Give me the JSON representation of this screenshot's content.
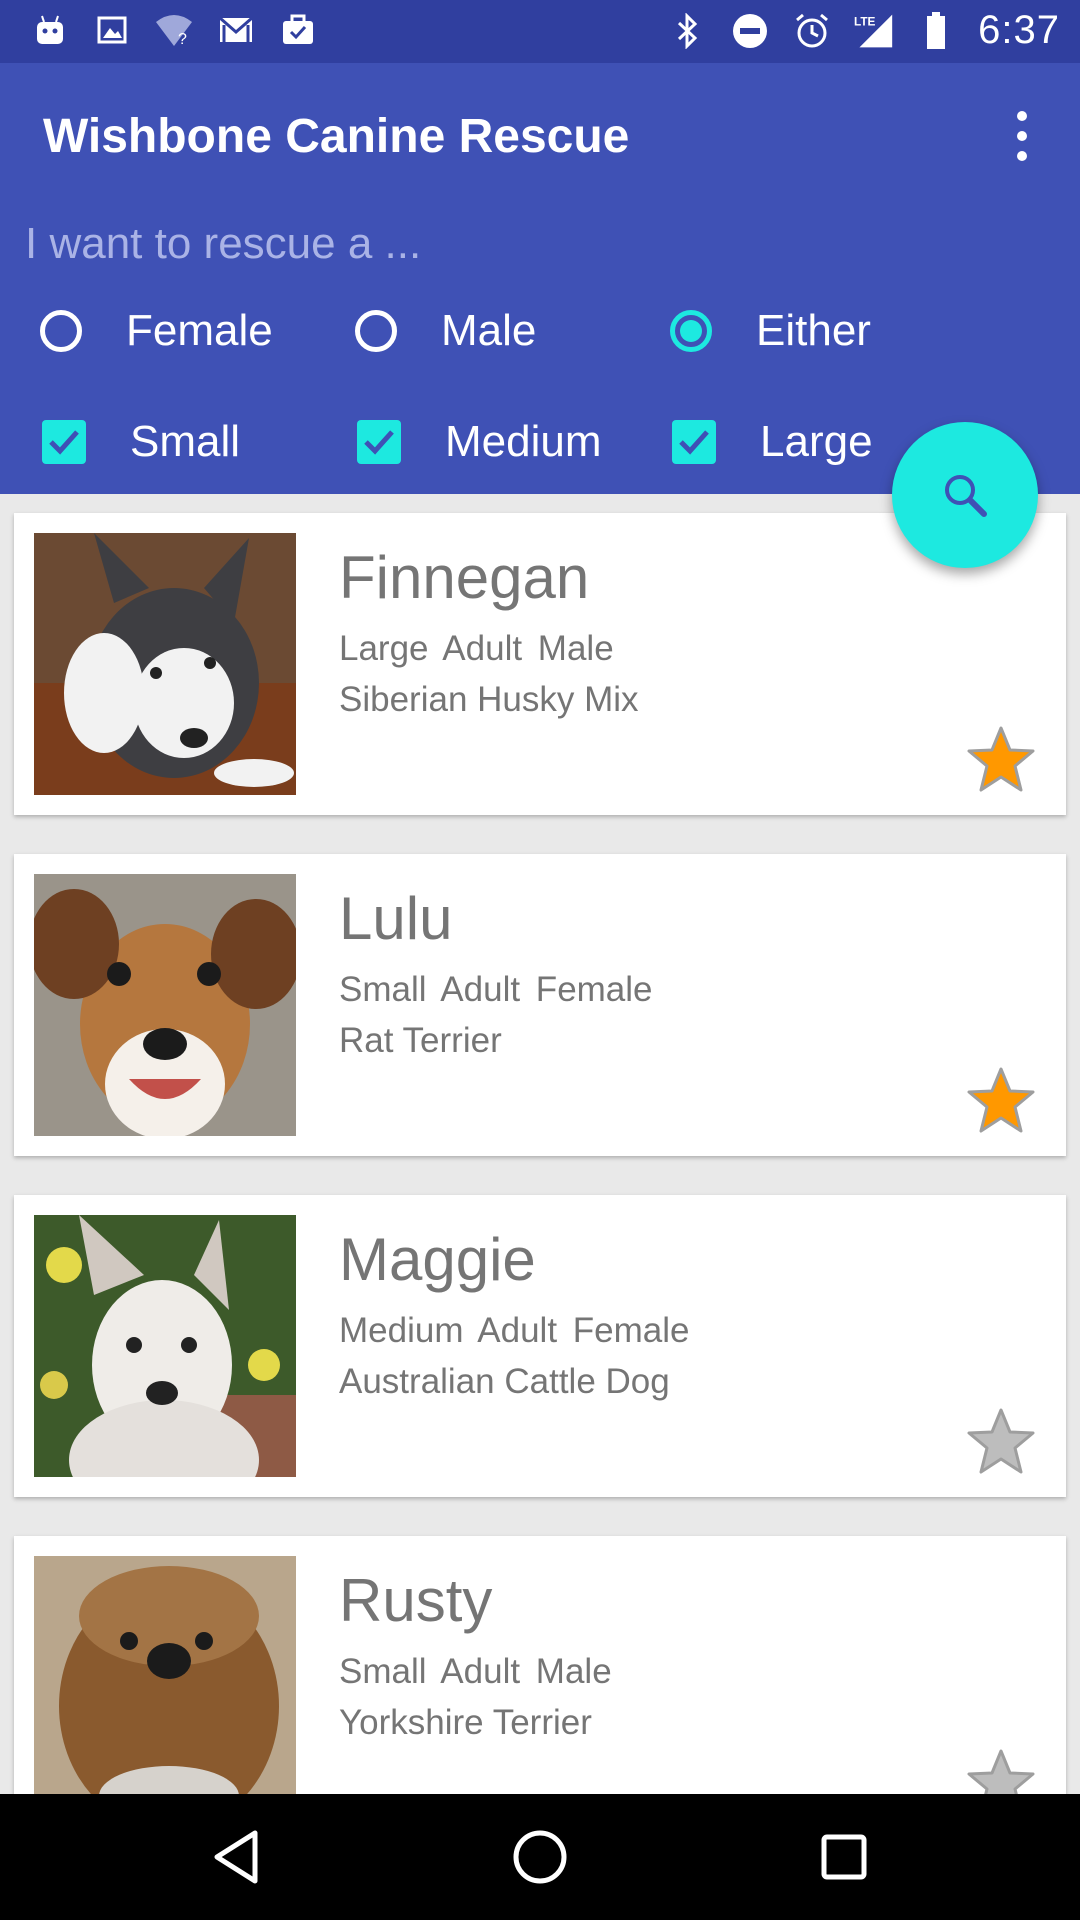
{
  "status_bar": {
    "time": "6:37",
    "left_icons": [
      "android-icon",
      "image-icon",
      "wifi-unknown-icon",
      "gmail-icon",
      "task-icon"
    ],
    "right_icons": [
      "bluetooth-icon",
      "do-not-disturb-icon",
      "alarm-icon",
      "lte-signal-icon",
      "battery-icon"
    ]
  },
  "app_bar": {
    "title": "Wishbone Canine Rescue",
    "prompt": "I want to rescue a ...",
    "sex_options": [
      {
        "label": "Female",
        "checked": false
      },
      {
        "label": "Male",
        "checked": false
      },
      {
        "label": "Either",
        "checked": true
      }
    ],
    "size_options": [
      {
        "label": "Small",
        "checked": true
      },
      {
        "label": "Medium",
        "checked": true
      },
      {
        "label": "Large",
        "checked": true
      }
    ]
  },
  "fab": {
    "icon": "search-icon"
  },
  "dogs": [
    {
      "name": "Finnegan",
      "meta": "Large  Adult  Male",
      "breed": "Siberian Husky Mix",
      "favorite": true
    },
    {
      "name": "Lulu",
      "meta": "Small  Adult  Female",
      "breed": "Rat Terrier",
      "favorite": true
    },
    {
      "name": "Maggie",
      "meta": "Medium  Adult  Female",
      "breed": "Australian Cattle Dog",
      "favorite": false
    },
    {
      "name": "Rusty",
      "meta": "Small  Adult  Male",
      "breed": "Yorkshire Terrier",
      "favorite": false
    }
  ],
  "colors": {
    "primary": "#3f51b5",
    "primary_dark": "#303f9f",
    "accent": "#1de9e0",
    "star_gold": "#ff9800",
    "star_gray": "#bdbdbd"
  },
  "nav_bar": {
    "icons": [
      "back-icon",
      "home-icon",
      "recents-icon"
    ]
  }
}
